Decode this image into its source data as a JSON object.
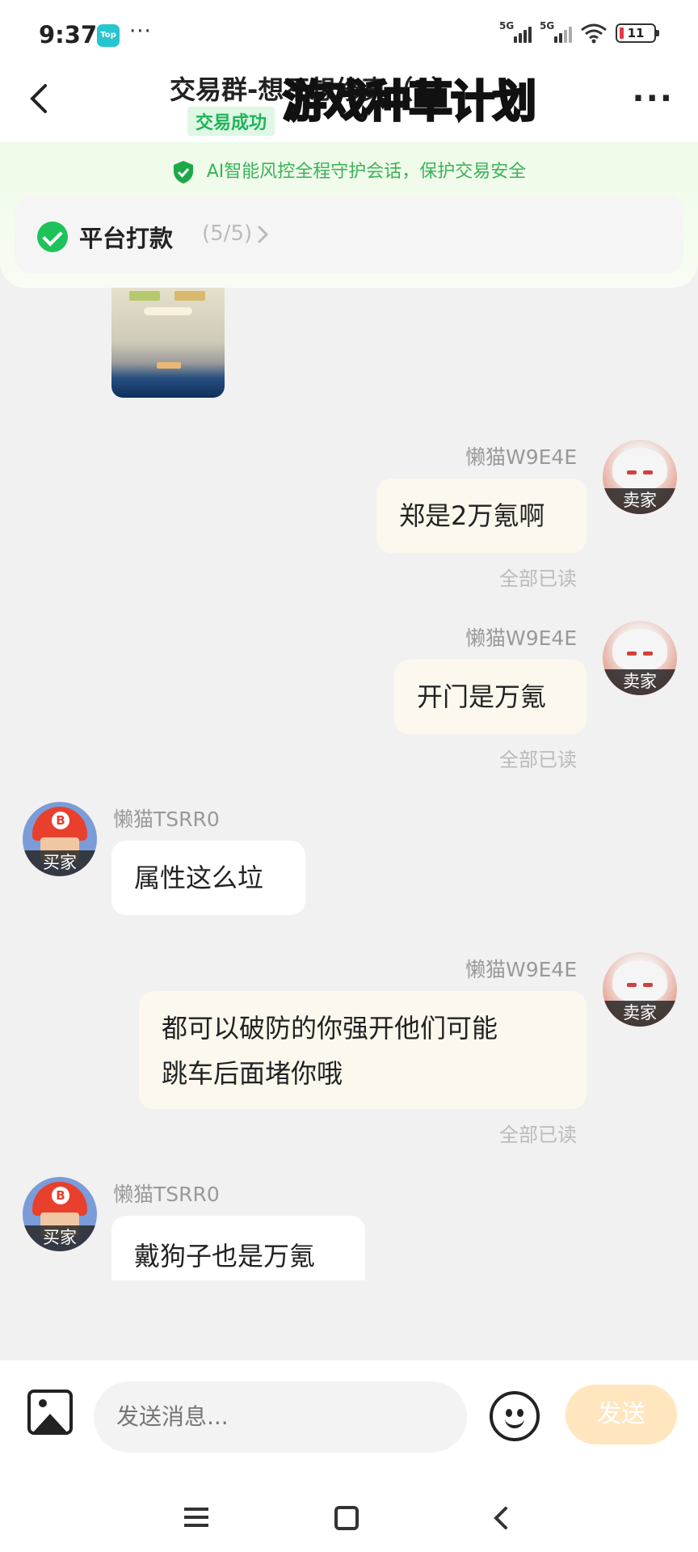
{
  "status": {
    "time": "9:37",
    "app_badge": "Top",
    "dots": "···",
    "sig1": "5G",
    "sig2": "5G",
    "battery": "11"
  },
  "header": {
    "title": "交易群-想不想修真（3）",
    "tag": "交易成功",
    "overlay": "游戏种草计划",
    "more": "···"
  },
  "safety": {
    "text": "AI智能风控全程守护会话，保护交易安全"
  },
  "payment": {
    "label": "平台打款",
    "count": "(5/5)"
  },
  "messages": [
    {
      "sender": "懒猫W9E4E",
      "role": "卖家",
      "text": "郑是2万氪啊",
      "read": "全部已读"
    },
    {
      "sender": "懒猫W9E4E",
      "role": "卖家",
      "text": "开门是万氪",
      "read": "全部已读"
    },
    {
      "sender": "懒猫TSRR0",
      "role": "买家",
      "text": "属性这么垃"
    },
    {
      "sender": "懒猫W9E4E",
      "role": "卖家",
      "text_line1": "都可以破防的你强开他们可能",
      "text_line2": "跳车后面堵你哦",
      "read": "全部已读"
    },
    {
      "sender": "懒猫TSRR0",
      "role": "买家",
      "text": "戴狗子也是万氪"
    }
  ],
  "input": {
    "placeholder": "发送消息...",
    "send_label": "发送"
  },
  "icons": {
    "back": "back-arrow-icon",
    "more": "more-icon",
    "shield": "shield-check-icon",
    "image": "image-icon",
    "emoji": "emoji-icon"
  },
  "colors": {
    "accent_green": "#1ec25a",
    "send_button": "#ffe6bf",
    "my_bubble": "#fdf8ee",
    "overlay_bg": "#f3a43a"
  }
}
